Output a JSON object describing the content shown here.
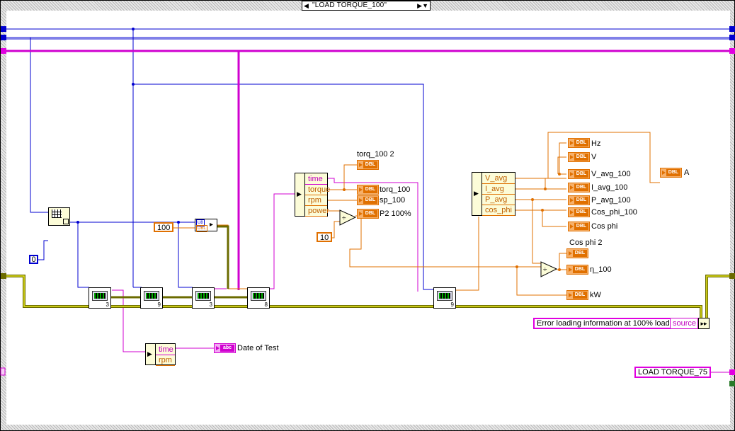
{
  "case_selector": {
    "label": "\"LOAD TORQUE_100\"",
    "decrement_glyph": "◀",
    "increment_glyph": "▶▼"
  },
  "constants": {
    "index_zero": "0",
    "hundred": "100",
    "ten": "10"
  },
  "unbundle_top": {
    "fields": [
      "time",
      "torque",
      "rpm",
      "power"
    ]
  },
  "unbundle_right": {
    "fields": [
      "V_avg",
      "I_avg",
      "P_avg",
      "cos_phi"
    ]
  },
  "unbundle_bottom": {
    "fields": [
      "time",
      "rpm"
    ]
  },
  "indicators": {
    "torq_100_2": "torq_100 2",
    "torq_100": "torq_100",
    "sp_100": "sp_100",
    "p2_100": "P2 100%",
    "hz": "Hz",
    "v": "V",
    "v_avg_100": "V_avg_100",
    "i_avg_100": "I_avg_100",
    "p_avg_100": "P_avg_100",
    "cos_phi_100": "Cos_phi_100",
    "cos_phi": "Cos phi",
    "a": "A",
    "cos_phi_2": "Cos phi 2",
    "eta_100": "η_100",
    "kw": "kW",
    "date_of_test": "Date of Test"
  },
  "terminal_tag": "DBL",
  "string_tag": "abc",
  "conversion_tags": [
    "U8",
    "DBL"
  ],
  "vi_numbers": [
    "3",
    "9",
    "3",
    "8",
    "9"
  ],
  "error_source": {
    "message": "Error loading information at 100% load",
    "source_label": "source"
  },
  "next_state": "LOAD TORQUE_75",
  "colors": {
    "wire_numeric_blue": "#0000d0",
    "wire_double_orange": "#e07000",
    "wire_string_pink": "#d000d0",
    "wire_error_cluster": "#6b6b00",
    "cluster_fill": "#fcfcd8"
  }
}
